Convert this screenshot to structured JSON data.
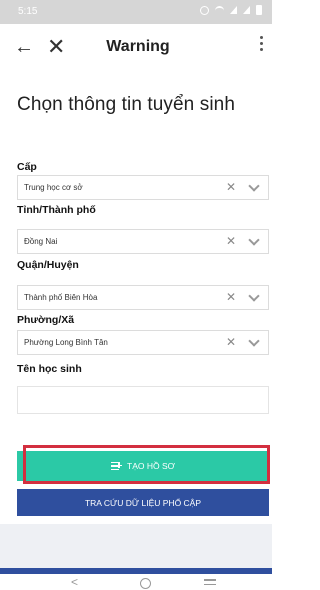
{
  "status_bar": {
    "time": "5:15"
  },
  "app_bar": {
    "title": "Warning"
  },
  "page": {
    "heading": "Chọn thông tin tuyển sinh"
  },
  "form": {
    "cap": {
      "label": "Cấp",
      "value": "Trung học cơ sở"
    },
    "tinh": {
      "label": "Tỉnh/Thành phố",
      "value": "Đồng Nai"
    },
    "quan": {
      "label": "Quận/Huyện",
      "value": "Thành phố Biên Hòa"
    },
    "phuong": {
      "label": "Phường/Xã",
      "value": "Phường Long Bình Tân"
    },
    "ten_hoc_sinh": {
      "label": "Tên học sinh",
      "value": ""
    }
  },
  "buttons": {
    "create": "TẠO HỒ SƠ",
    "lookup": "TRA CỨU DỮ LIỆU PHỔ CẬP"
  },
  "colors": {
    "create_button": "#2bc9a6",
    "lookup_button": "#2f4f9e",
    "highlight": "#d32f3f"
  }
}
